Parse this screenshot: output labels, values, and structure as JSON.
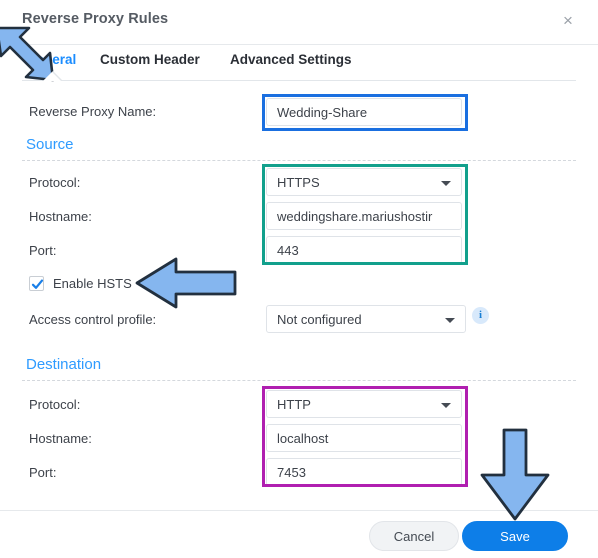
{
  "dialog": {
    "title": "Reverse Proxy Rules",
    "close_icon": "×"
  },
  "tabs": [
    {
      "label": "General",
      "active": true
    },
    {
      "label": "Custom Header",
      "active": false
    },
    {
      "label": "Advanced Settings",
      "active": false
    }
  ],
  "form": {
    "name_label": "Reverse Proxy Name:",
    "name_value": "Wedding-Share",
    "source_heading": "Source",
    "source": {
      "protocol_label": "Protocol:",
      "protocol_value": "HTTPS",
      "hostname_label": "Hostname:",
      "hostname_value": "weddingshare.mariushostir",
      "port_label": "Port:",
      "port_value": "443"
    },
    "hsts_label": "Enable HSTS",
    "hsts_checked": true,
    "acl_label": "Access control profile:",
    "acl_value": "Not configured",
    "info_icon_glyph": "i",
    "destination_heading": "Destination",
    "destination": {
      "protocol_label": "Protocol:",
      "protocol_value": "HTTP",
      "hostname_label": "Hostname:",
      "hostname_value": "localhost",
      "port_label": "Port:",
      "port_value": "7453"
    }
  },
  "footer": {
    "cancel_label": "Cancel",
    "save_label": "Save"
  },
  "annotations": {
    "arrow_fill": "#85b6ef",
    "arrow_stroke": "#22303f",
    "box_blue": "#1a6fe0",
    "box_teal": "#12a08c",
    "box_magenta": "#b01fb0"
  }
}
